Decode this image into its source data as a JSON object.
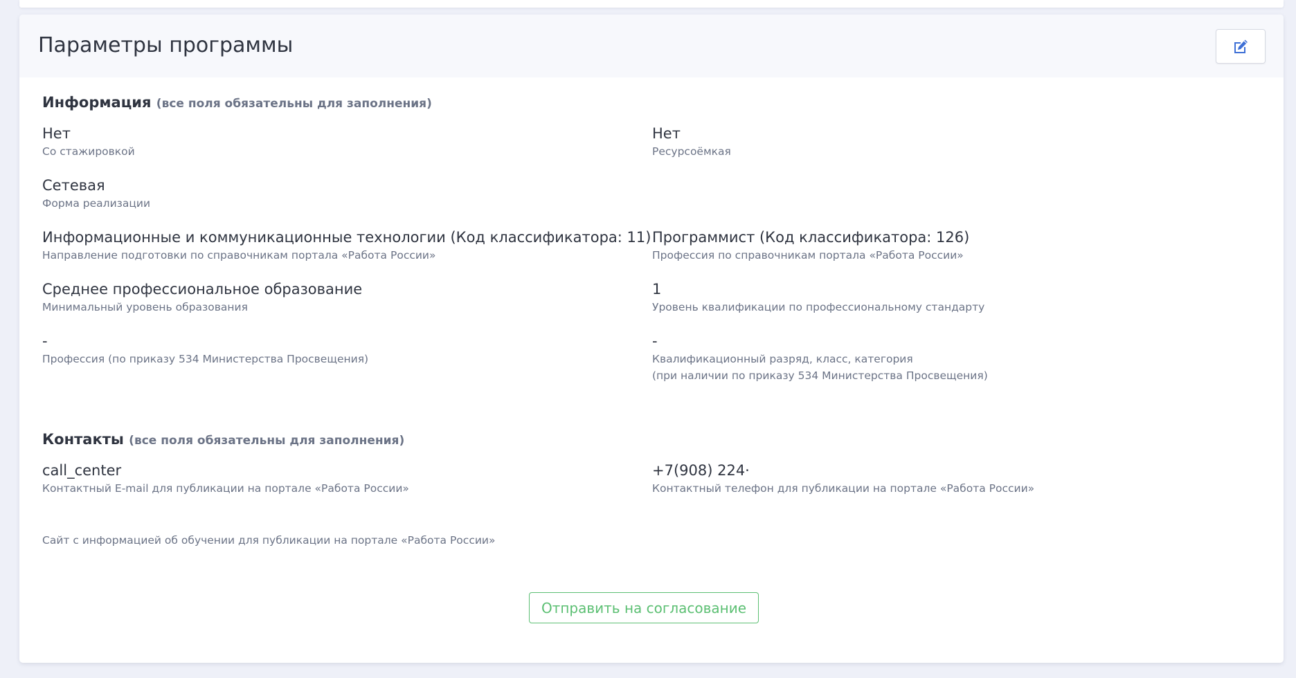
{
  "header": {
    "title": "Параметры программы",
    "edit_icon": "edit-icon",
    "accent": "#3d6fd6"
  },
  "info_section": {
    "title": "Информация",
    "note": "(все поля обязательны для заполнения)",
    "fields": [
      {
        "value": "Нет",
        "label": "Со стажировкой"
      },
      {
        "value": "Нет",
        "label": "Ресурсоёмкая"
      },
      {
        "value": "Сетевая",
        "label": "Форма реализации"
      },
      {
        "value": "Информационные и коммуникационные технологии (Код классификатора: 11)",
        "label": "Направление подготовки по справочникам портала «Работа России»"
      },
      {
        "value": "Программист (Код классификатора: 126)",
        "label": "Профессия по справочникам портала «Работа России»"
      },
      {
        "value": "Среднее профессиональное образование",
        "label": "Минимальный уровень образования"
      },
      {
        "value": "1",
        "label": "Уровень квалификации по профессиональному стандарту"
      },
      {
        "value": "-",
        "label": "Профессия (по приказу 534 Министерства Просвещения)"
      },
      {
        "value": "-",
        "label": "Квалификационный разряд, класс, категория",
        "label2": "(при наличии по приказу 534 Министерства Просвещения)"
      }
    ]
  },
  "contacts_section": {
    "title": "Контакты",
    "note": "(все поля обязательны для заполнения)",
    "fields": [
      {
        "value": "call_center",
        "label": "Контактный E-mail для публикации на портале «Работа России»"
      },
      {
        "value": "+7(908) 224·",
        "label": "Контактный телефон для публикации на портале «Работа России»"
      },
      {
        "value": "",
        "label": "Сайт с информацией об обучении для публикации на портале «Работа России»"
      }
    ]
  },
  "actions": {
    "submit_label": "Отправить на согласование",
    "submit_color": "#5bbf72"
  }
}
